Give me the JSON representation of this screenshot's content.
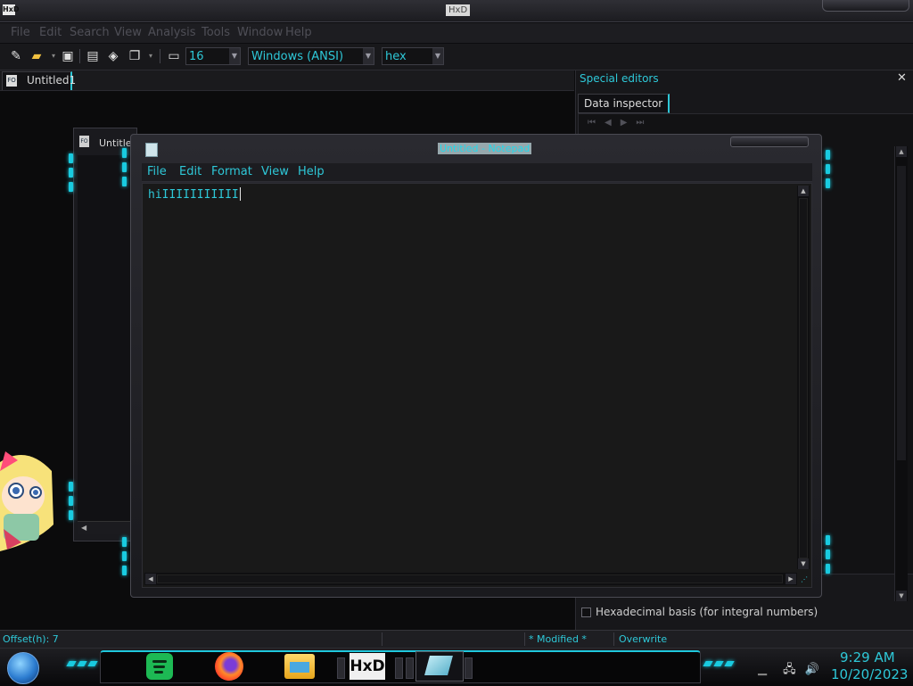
{
  "hxd": {
    "app_icon": "HxD",
    "title": "HxD",
    "menu": [
      "File",
      "Edit",
      "Search",
      "View",
      "Analysis",
      "Tools",
      "Window",
      "Help"
    ],
    "toolbar": {
      "bytes_per_row": "16",
      "charset": "Windows (ANSI)",
      "offset_base": "hex"
    },
    "doc_tab": "Untitled1",
    "special_editors": {
      "title": "Special editors",
      "close": "✕",
      "tab": "Data inspector",
      "hex_basis_label": "Hexadecimal basis (for integral numbers)"
    },
    "status": {
      "offset": "Offset(h): 7",
      "modified": "* Modified *",
      "mode": "Overwrite"
    },
    "child_title": "Untitle"
  },
  "notepad": {
    "title": "Untitled - Notepad",
    "menu": [
      "File",
      "Edit",
      "Format",
      "View",
      "Help"
    ],
    "text": "hiIIIIIIIIIII"
  },
  "taskbar": {
    "time": "9:29 AM",
    "date": "10/20/2023",
    "hxd_label": "HxD"
  },
  "colors": {
    "accent": "#2ec8d8",
    "background": "#0c0c0e"
  }
}
